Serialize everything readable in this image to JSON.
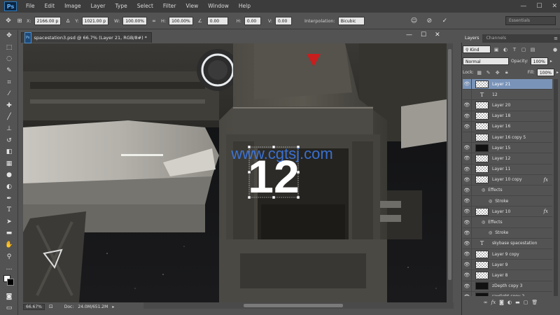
{
  "app": {
    "logo": "Ps"
  },
  "menu": [
    "File",
    "Edit",
    "Image",
    "Layer",
    "Type",
    "Select",
    "Filter",
    "View",
    "Window",
    "Help"
  ],
  "window_controls": {
    "minimize": "—",
    "maximize": "☐",
    "close": "✕"
  },
  "options_bar": {
    "x_label": "X:",
    "x_value": "2166.00 p",
    "y_label": "Y:",
    "y_value": "1021.00 p",
    "w_label": "W:",
    "w_value": "100.00%",
    "h_label": "H:",
    "h_value": "100.00%",
    "angle_value": "0.00",
    "hskew_label": "H:",
    "hskew_value": "0.00",
    "vskew_label": "V:",
    "vskew_value": "0.00",
    "interp_label": "Interpolation:",
    "interp_value": "Bicubic",
    "workspace": "Essentials"
  },
  "document": {
    "tab_title": "spacestation3.psd @ 66.7% (Layer 21, RGB/8#) *",
    "controls": {
      "minimize": "—",
      "maximize": "☐",
      "close": "✕"
    },
    "big_text": "12",
    "watermark": "www.cgtsj.com"
  },
  "status": {
    "zoom": "66.67%",
    "doc_label": "Doc:",
    "doc_size": "24.0M/651.2M"
  },
  "panel": {
    "tabs": [
      "Layers",
      "Channels"
    ],
    "filter_kind": "Kind",
    "blend_mode": "Normal",
    "opacity_label": "Opacity:",
    "opacity_value": "100%",
    "lock_label": "Lock:",
    "fill_label": "Fill:",
    "fill_value": "100%",
    "layers": [
      {
        "name": "Layer 21",
        "kind": "pixel",
        "visible": true,
        "selected": true
      },
      {
        "name": "12",
        "kind": "text",
        "visible": false
      },
      {
        "name": "Layer 20",
        "kind": "pixel",
        "visible": true
      },
      {
        "name": "Layer 18",
        "kind": "pixel",
        "visible": true
      },
      {
        "name": "Layer 16",
        "kind": "pixel",
        "visible": true
      },
      {
        "name": "Layer 16 copy 5",
        "kind": "pixel",
        "visible": false
      },
      {
        "name": "Layer 15",
        "kind": "pixel-dark",
        "visible": true
      },
      {
        "name": "Layer 12",
        "kind": "pixel",
        "visible": true
      },
      {
        "name": "Layer 11",
        "kind": "pixel",
        "visible": true
      },
      {
        "name": "Layer 10 copy",
        "kind": "pixel",
        "visible": true,
        "fx": "fx"
      },
      {
        "name": "Effects",
        "kind": "effects",
        "visible": true
      },
      {
        "name": "Stroke",
        "kind": "effect",
        "visible": true
      },
      {
        "name": "Layer 10",
        "kind": "pixel",
        "visible": true,
        "fx": "fx"
      },
      {
        "name": "Effects",
        "kind": "effects",
        "visible": true
      },
      {
        "name": "Stroke",
        "kind": "effect",
        "visible": true
      },
      {
        "name": "skybase spacestation",
        "kind": "text",
        "visible": true
      },
      {
        "name": "Layer 9 copy",
        "kind": "pixel",
        "visible": true
      },
      {
        "name": "Layer 9",
        "kind": "pixel",
        "visible": true
      },
      {
        "name": "Layer 8",
        "kind": "pixel",
        "visible": true
      },
      {
        "name": "zDepth copy 3",
        "kind": "pixel-dark",
        "visible": true
      },
      {
        "name": "rawlight copy 2",
        "kind": "pixel-dark",
        "visible": true
      }
    ]
  },
  "colors": {
    "accent": "#7993b8",
    "chrome_dark": "#3c3c3c",
    "chrome": "#535353",
    "red_marker": "#c81e1e"
  }
}
